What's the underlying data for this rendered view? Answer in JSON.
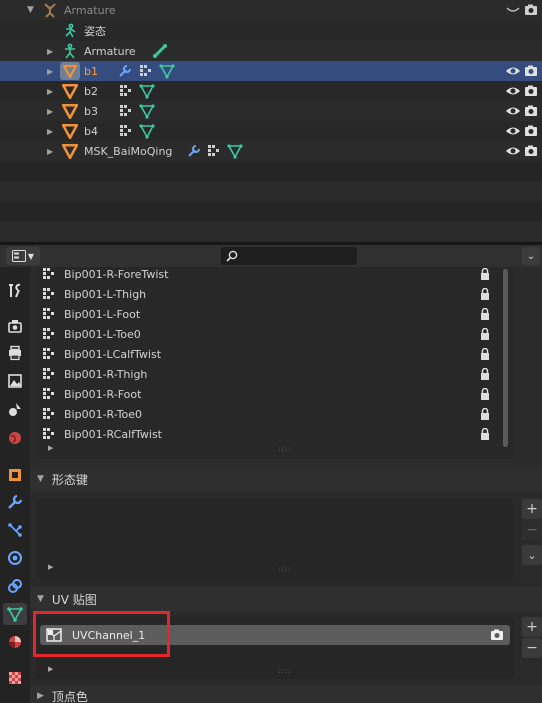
{
  "outliner": {
    "rows": [
      {
        "id": "armature-parent",
        "label": "Armature",
        "label_dim": true
      },
      {
        "id": "pose",
        "label": "姿态"
      },
      {
        "id": "armature-child",
        "label": "Armature"
      },
      {
        "id": "b1",
        "label": "b1",
        "selected": true
      },
      {
        "id": "b2",
        "label": "b2"
      },
      {
        "id": "b3",
        "label": "b3"
      },
      {
        "id": "b4",
        "label": "b4"
      },
      {
        "id": "msk",
        "label": "MSK_BaiMoQing"
      }
    ]
  },
  "header": {
    "search_placeholder": ""
  },
  "vertex_groups": {
    "items": [
      {
        "label": "Bip001-R-ForeTwist"
      },
      {
        "label": "Bip001-L-Thigh"
      },
      {
        "label": "Bip001-L-Foot"
      },
      {
        "label": "Bip001-L-Toe0"
      },
      {
        "label": "Bip001-LCalfTwist"
      },
      {
        "label": "Bip001-R-Thigh"
      },
      {
        "label": "Bip001-R-Foot"
      },
      {
        "label": "Bip001-R-Toe0"
      },
      {
        "label": "Bip001-RCalfTwist"
      }
    ]
  },
  "shape_keys": {
    "title": "形态键"
  },
  "uv_maps": {
    "title": "UV 贴图",
    "items": [
      {
        "label": "UVChannel_1"
      }
    ]
  },
  "vertex_colors": {
    "title": "顶点色"
  },
  "side_buttons": {
    "add": "+",
    "remove": "−"
  },
  "colors": {
    "selected_row": "#344d7e",
    "highlight_box": "#e3262b",
    "mesh_orange": "#f0923a",
    "mesh_green": "#3cc9a0"
  }
}
